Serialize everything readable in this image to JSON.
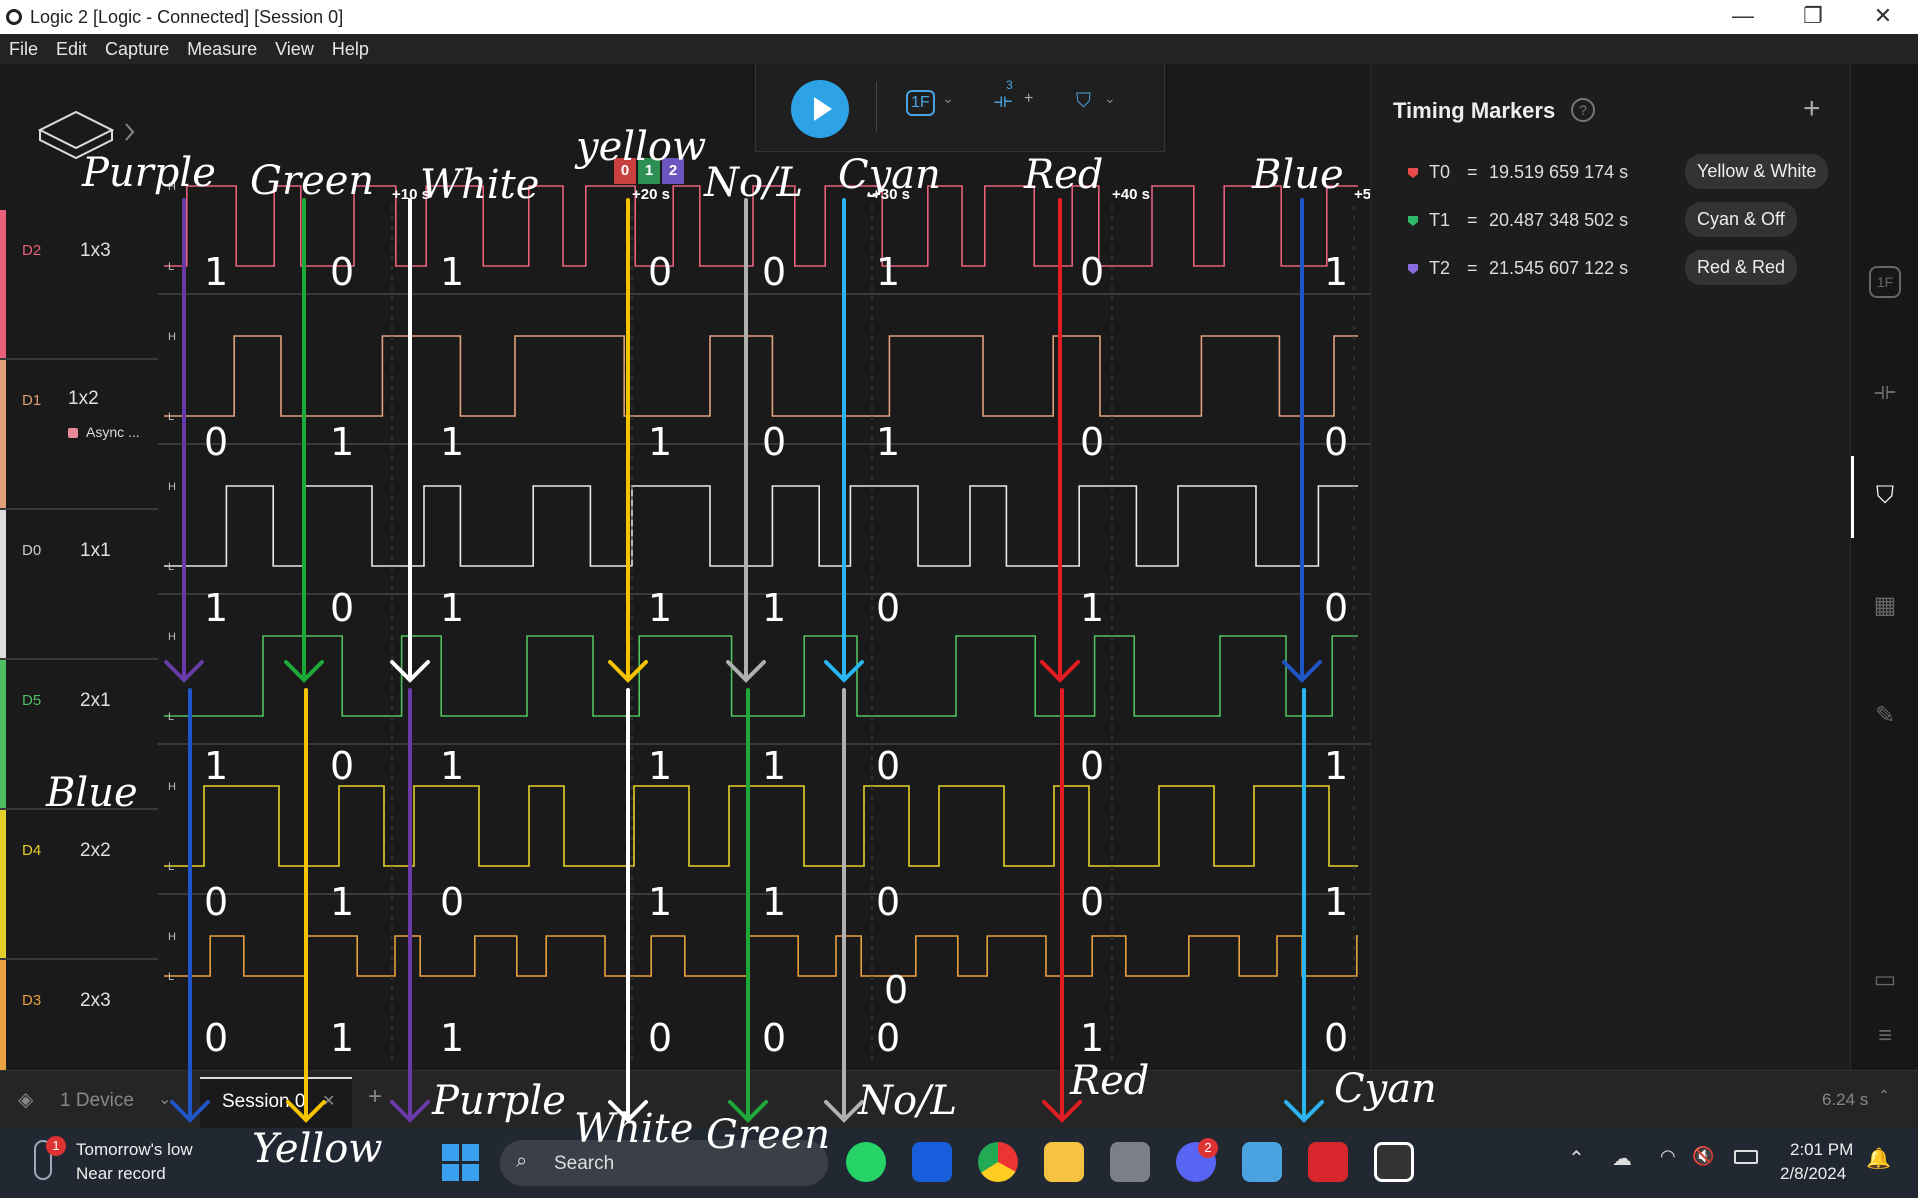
{
  "window": {
    "title": "Logic 2 [Logic - Connected] [Session 0]",
    "minimize": "—",
    "maximize": "❐",
    "close": "✕"
  },
  "menu": [
    "File",
    "Edit",
    "Capture",
    "Measure",
    "View",
    "Help"
  ],
  "toolbar": {
    "trigger_label": "1F",
    "split_label": "3",
    "split_plus": "+"
  },
  "timeline": {
    "ticks": [
      "+10 s",
      "+20 s",
      "+30 s",
      "+40 s",
      "+5"
    ],
    "markers": [
      "0",
      "1",
      "2"
    ]
  },
  "channels": [
    {
      "id": "D2",
      "name": "1x3",
      "color": "#e8607a",
      "id_color": "#e8607a"
    },
    {
      "id": "D1",
      "name": "1x2",
      "color": "#e0a07a",
      "id_color": "#e0a07a",
      "analyzer": "Async ..."
    },
    {
      "id": "D0",
      "name": "1x1",
      "color": "#e8e8e8",
      "id_color": "#cccccc"
    },
    {
      "id": "D5",
      "name": "2x1",
      "color": "#4fbf5f",
      "id_color": "#4fbf5f"
    },
    {
      "id": "D4",
      "name": "2x2",
      "color": "#e4cf2a",
      "id_color": "#e4cf2a"
    },
    {
      "id": "D3",
      "name": "2x3",
      "color": "#e8a040",
      "id_color": "#e8a040"
    }
  ],
  "timing_markers": {
    "title": "Timing Markers",
    "help": "?",
    "add": "+",
    "rows": [
      {
        "name": "T0",
        "eq": "=",
        "time": "19.519 659 174 s",
        "label": "Yellow & White",
        "color": "#e84c4c"
      },
      {
        "name": "T1",
        "eq": "=",
        "time": "20.487 348 502 s",
        "label": "Cyan & Off",
        "color": "#2fb86a"
      },
      {
        "name": "T2",
        "eq": "=",
        "time": "21.545 607 122 s",
        "label": "Red & Red",
        "color": "#8b6be0"
      }
    ]
  },
  "bottom": {
    "device": "1 Device",
    "session": "Session 0",
    "add_tab": "+",
    "duration": "6.24 s"
  },
  "taskbar": {
    "weather_line1": "Tomorrow's low",
    "weather_line2": "Near record",
    "weather_badge": "1",
    "search": "Search",
    "time": "2:01 PM",
    "date": "2/8/2024",
    "discord_badge": "2"
  },
  "annotations": {
    "top": [
      "Purple",
      "Green",
      "White",
      "yellow",
      "No/L",
      "Cyan",
      "Red",
      "Blue"
    ],
    "left": "Blue",
    "bottom": [
      "Yellow",
      "Purple",
      "White",
      "Green",
      "No/L",
      "Red",
      "Cyan"
    ],
    "digits": {
      "D2": [
        "1",
        "0",
        "1",
        "0",
        "0",
        "1",
        "0",
        "1"
      ],
      "D1": [
        "0",
        "1",
        "1",
        "1",
        "0",
        "1",
        "0",
        "0"
      ],
      "D0": [
        "1",
        "0",
        "1",
        "1",
        "1",
        "0",
        "1",
        "0"
      ],
      "D5": [
        "1",
        "0",
        "1",
        "1",
        "1",
        "0",
        "0",
        "1"
      ],
      "D4": [
        "0",
        "1",
        "0",
        "1",
        "1",
        "0",
        "0",
        "1"
      ],
      "D3": [
        "0",
        "1",
        "1",
        "0",
        "0",
        "0",
        "1",
        "0"
      ]
    },
    "extra_digit": "0"
  }
}
